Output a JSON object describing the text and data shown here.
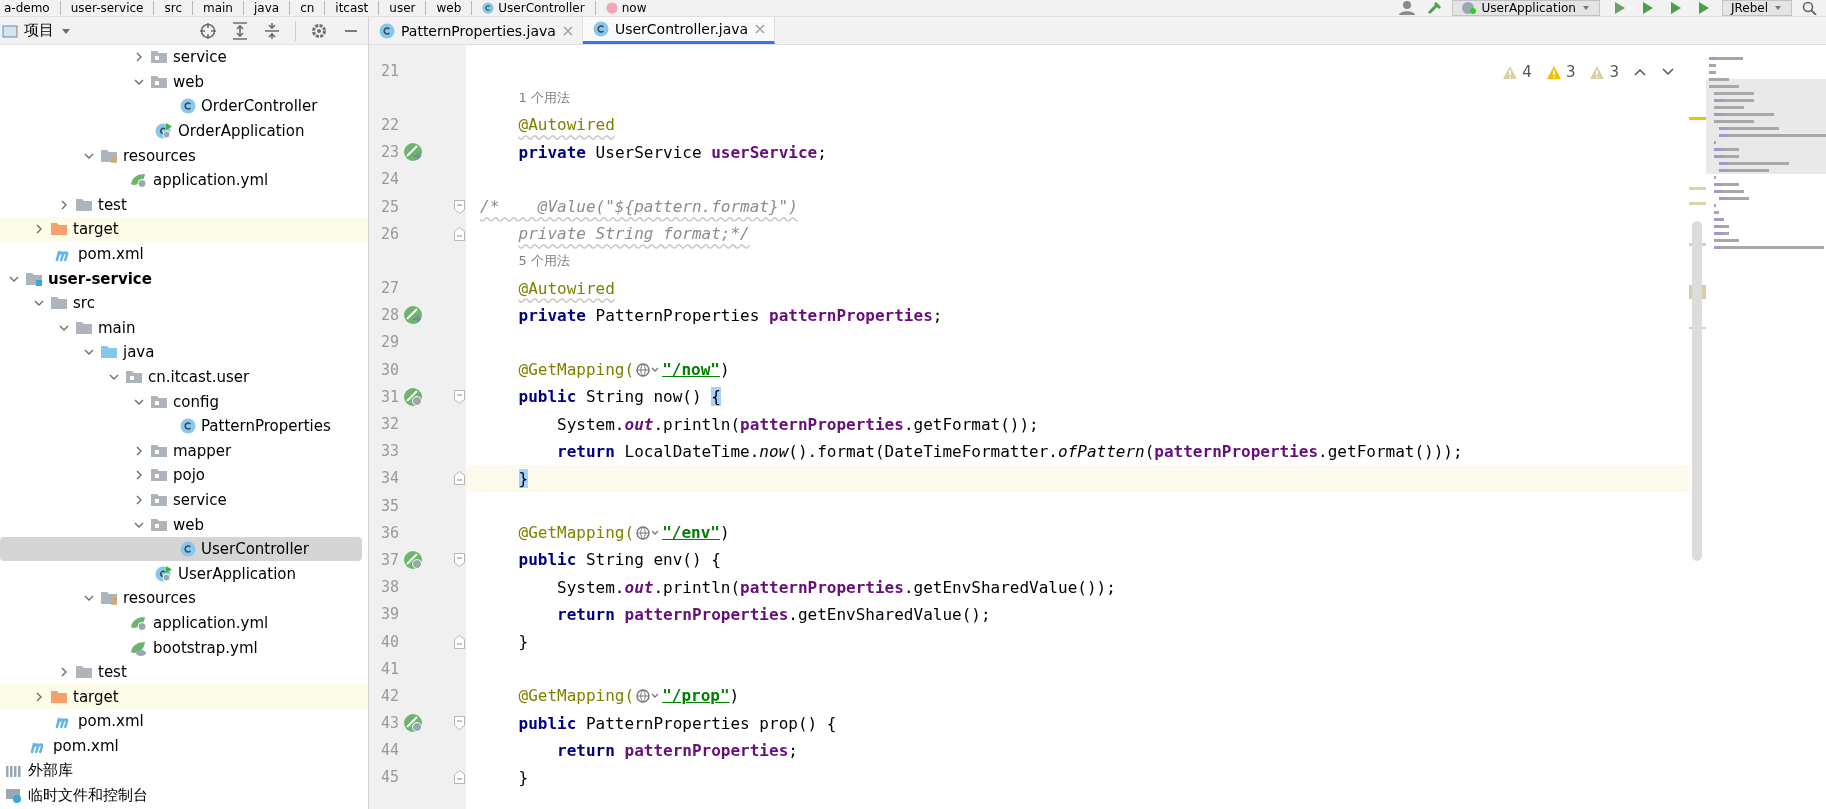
{
  "breadcrumb": [
    {
      "label": "a-demo",
      "kind": "folder"
    },
    {
      "label": "user-service",
      "kind": "folder"
    },
    {
      "label": "src",
      "kind": "folder"
    },
    {
      "label": "main",
      "kind": "folder"
    },
    {
      "label": "java",
      "kind": "folder"
    },
    {
      "label": "cn",
      "kind": "folder"
    },
    {
      "label": "itcast",
      "kind": "folder"
    },
    {
      "label": "user",
      "kind": "folder"
    },
    {
      "label": "web",
      "kind": "folder"
    },
    {
      "label": "UserController",
      "kind": "class"
    },
    {
      "label": "now",
      "kind": "method"
    }
  ],
  "toolbar": {
    "run_config": "UserApplication",
    "jrebel": "JRebel"
  },
  "project_panel": {
    "title": "项目",
    "tree": [
      {
        "children": [
          {
            "children": [
              {
                "children": [
                  {
                    "children": [
                      {
                        "children": [
                          {
                            "children": [
                              {
                                "label": "service",
                                "kind": "package",
                                "expanded": false,
                                "selected": false
                              },
                              {
                                "label": "web",
                                "kind": "package",
                                "expanded": true,
                                "selected": false,
                                "children": [
                                  {
                                    "label": "OrderController",
                                    "kind": "class",
                                    "selected": false
                                  }
                                ]
                              },
                              {
                                "label": "OrderApplication",
                                "kind": "app-class",
                                "selected": false
                              }
                            ]
                          }
                        ]
                      },
                      {
                        "label": "resources",
                        "kind": "resources-folder",
                        "expanded": true,
                        "selected": false,
                        "children": [
                          {
                            "label": "application.yml",
                            "kind": "yml",
                            "selected": false
                          }
                        ]
                      }
                    ]
                  },
                  {
                    "label": "test",
                    "kind": "folder",
                    "expanded": false,
                    "selected": false
                  }
                ]
              },
              {
                "label": "target",
                "kind": "excluded-folder",
                "expanded": false,
                "selected": false
              },
              {
                "label": "pom.xml",
                "kind": "maven",
                "selected": false
              }
            ]
          },
          {
            "label": "user-service",
            "kind": "module",
            "expanded": true,
            "selected": false,
            "children": [
              {
                "label": "src",
                "kind": "folder",
                "expanded": true,
                "selected": false,
                "children": [
                  {
                    "label": "main",
                    "kind": "folder",
                    "expanded": true,
                    "selected": false,
                    "children": [
                      {
                        "label": "java",
                        "kind": "source-folder",
                        "expanded": true,
                        "selected": false,
                        "children": [
                          {
                            "label": "cn.itcast.user",
                            "kind": "package",
                            "expanded": true,
                            "selected": false,
                            "children": [
                              {
                                "label": "config",
                                "kind": "package",
                                "expanded": true,
                                "selected": false,
                                "children": [
                                  {
                                    "label": "PatternProperties",
                                    "kind": "class",
                                    "selected": false
                                  }
                                ]
                              },
                              {
                                "label": "mapper",
                                "kind": "package",
                                "expanded": false,
                                "selected": false
                              },
                              {
                                "label": "pojo",
                                "kind": "package",
                                "expanded": false,
                                "selected": false
                              },
                              {
                                "label": "service",
                                "kind": "package",
                                "expanded": false,
                                "selected": false
                              },
                              {
                                "label": "web",
                                "kind": "package",
                                "expanded": true,
                                "selected": false,
                                "children": [
                                  {
                                    "label": "UserController",
                                    "kind": "class",
                                    "selected": true
                                  }
                                ]
                              },
                              {
                                "label": "UserApplication",
                                "kind": "app-class",
                                "selected": false
                              }
                            ]
                          }
                        ]
                      },
                      {
                        "label": "resources",
                        "kind": "resources-folder",
                        "expanded": true,
                        "selected": false,
                        "children": [
                          {
                            "label": "application.yml",
                            "kind": "yml",
                            "selected": false
                          },
                          {
                            "label": "bootstrap.yml",
                            "kind": "bootstrap-yml",
                            "selected": false
                          }
                        ]
                      }
                    ]
                  },
                  {
                    "label": "test",
                    "kind": "folder",
                    "expanded": false,
                    "selected": false
                  }
                ]
              },
              {
                "label": "target",
                "kind": "excluded-folder",
                "expanded": false,
                "selected": false
              },
              {
                "label": "pom.xml",
                "kind": "maven",
                "selected": false
              }
            ]
          },
          {
            "label": "pom.xml",
            "kind": "maven",
            "selected": false
          }
        ]
      },
      {
        "label": "外部库",
        "kind": "libraries",
        "selected": false
      },
      {
        "label": "临时文件和控制台",
        "kind": "scratches",
        "selected": false
      }
    ]
  },
  "tabs": [
    {
      "label": "PatternProperties.java",
      "selected": false
    },
    {
      "label": "UserController.java",
      "selected": true
    }
  ],
  "inspections": [
    {
      "kind": "weak-warning",
      "count": "4"
    },
    {
      "kind": "warning",
      "count": "3"
    },
    {
      "kind": "typo",
      "count": "3"
    }
  ],
  "code": [
    {
      "kind": "code",
      "number": "21"
    },
    {
      "kind": "hint",
      "text": "1 个用法"
    },
    {
      "kind": "code",
      "number": "22",
      "tokens": [
        {
          "kind": "annotation-warn",
          "text": "    @Autowired"
        }
      ]
    },
    {
      "kind": "code",
      "number": "23",
      "marker": {
        "kind": "bean"
      },
      "tokens": [
        {
          "kind": "keyword",
          "text": "    private"
        },
        {
          "kind": "plain",
          "text": " UserService "
        },
        {
          "kind": "field",
          "text": "userService"
        },
        {
          "kind": "plain",
          "text": ";"
        }
      ]
    },
    {
      "kind": "code",
      "number": "24"
    },
    {
      "kind": "code",
      "number": "25",
      "fold": {
        "kind": "start"
      },
      "tokens": [
        {
          "kind": "comment-warn",
          "text": "/*    @Value(\"${pattern.format}\")"
        }
      ]
    },
    {
      "kind": "code",
      "number": "26",
      "fold": {
        "kind": "end"
      },
      "tokens": [
        {
          "kind": "comment-warn",
          "text": "    private String format;*/"
        }
      ]
    },
    {
      "kind": "hint",
      "text": "5 个用法"
    },
    {
      "kind": "code",
      "number": "27",
      "tokens": [
        {
          "kind": "annotation-warn",
          "text": "    @Autowired"
        }
      ]
    },
    {
      "kind": "code",
      "number": "28",
      "marker": {
        "kind": "bean"
      },
      "tokens": [
        {
          "kind": "keyword",
          "text": "    private"
        },
        {
          "kind": "plain",
          "text": " PatternProperties "
        },
        {
          "kind": "field",
          "text": "patternProperties"
        },
        {
          "kind": "plain",
          "text": ";"
        }
      ]
    },
    {
      "kind": "code",
      "number": "29"
    },
    {
      "kind": "code",
      "number": "30",
      "tokens": [
        {
          "kind": "annotation",
          "text": "    @GetMapping("
        },
        {
          "kind": "globe"
        },
        {
          "kind": "url",
          "text": "\"/now\""
        },
        {
          "kind": "plain",
          "text": ")"
        }
      ]
    },
    {
      "kind": "code",
      "number": "31",
      "marker": {
        "kind": "endpoint"
      },
      "fold": {
        "kind": "start"
      },
      "tokens": [
        {
          "kind": "keyword",
          "text": "    public"
        },
        {
          "kind": "plain",
          "text": " String now() "
        },
        {
          "kind": "brace-match",
          "text": "{"
        }
      ]
    },
    {
      "kind": "code",
      "number": "32",
      "tokens": [
        {
          "kind": "plain",
          "text": "        System."
        },
        {
          "kind": "static-field",
          "text": "out"
        },
        {
          "kind": "plain",
          "text": ".println("
        },
        {
          "kind": "field",
          "text": "patternProperties"
        },
        {
          "kind": "plain",
          "text": ".getFormat());"
        }
      ]
    },
    {
      "kind": "code",
      "number": "33",
      "tokens": [
        {
          "kind": "keyword",
          "text": "        return"
        },
        {
          "kind": "plain",
          "text": " LocalDateTime."
        },
        {
          "kind": "static-method",
          "text": "now"
        },
        {
          "kind": "plain",
          "text": "().format(DateTimeFormatter."
        },
        {
          "kind": "static-method",
          "text": "ofPattern"
        },
        {
          "kind": "plain",
          "text": "("
        },
        {
          "kind": "field",
          "text": "patternProperties"
        },
        {
          "kind": "plain",
          "text": ".getFormat()));"
        }
      ]
    },
    {
      "kind": "current",
      "number": "34",
      "fold": {
        "kind": "end"
      },
      "tokens": [
        {
          "kind": "brace-match",
          "text": "    }"
        }
      ]
    },
    {
      "kind": "code",
      "number": "35"
    },
    {
      "kind": "code",
      "number": "36",
      "tokens": [
        {
          "kind": "annotation",
          "text": "    @GetMapping("
        },
        {
          "kind": "globe"
        },
        {
          "kind": "url",
          "text": "\"/env\""
        },
        {
          "kind": "plain",
          "text": ")"
        }
      ]
    },
    {
      "kind": "code",
      "number": "37",
      "marker": {
        "kind": "endpoint"
      },
      "fold": {
        "kind": "start"
      },
      "tokens": [
        {
          "kind": "keyword",
          "text": "    public"
        },
        {
          "kind": "plain",
          "text": " String env() {"
        }
      ]
    },
    {
      "kind": "code",
      "number": "38",
      "tokens": [
        {
          "kind": "plain",
          "text": "        System."
        },
        {
          "kind": "static-field",
          "text": "out"
        },
        {
          "kind": "plain",
          "text": ".println("
        },
        {
          "kind": "field",
          "text": "patternProperties"
        },
        {
          "kind": "plain",
          "text": ".getEnvSharedValue());"
        }
      ]
    },
    {
      "kind": "code",
      "number": "39",
      "tokens": [
        {
          "kind": "keyword",
          "text": "        return"
        },
        {
          "kind": "field",
          "text": " patternProperties"
        },
        {
          "kind": "plain",
          "text": ".getEnvSharedValue();"
        }
      ]
    },
    {
      "kind": "code",
      "number": "40",
      "fold": {
        "kind": "end"
      },
      "tokens": [
        {
          "kind": "plain",
          "text": "    }"
        }
      ]
    },
    {
      "kind": "code",
      "number": "41"
    },
    {
      "kind": "code",
      "number": "42",
      "tokens": [
        {
          "kind": "annotation",
          "text": "    @GetMapping("
        },
        {
          "kind": "globe"
        },
        {
          "kind": "url",
          "text": "\"/prop\""
        },
        {
          "kind": "plain",
          "text": ")"
        }
      ]
    },
    {
      "kind": "code",
      "number": "43",
      "marker": {
        "kind": "endpoint"
      },
      "fold": {
        "kind": "start"
      },
      "tokens": [
        {
          "kind": "keyword",
          "text": "    public"
        },
        {
          "kind": "plain",
          "text": " PatternProperties prop() {"
        }
      ]
    },
    {
      "kind": "code",
      "number": "44",
      "tokens": [
        {
          "kind": "keyword",
          "text": "        return"
        },
        {
          "kind": "field",
          "text": " patternProperties"
        },
        {
          "kind": "plain",
          "text": ";"
        }
      ]
    },
    {
      "kind": "code",
      "number": "45",
      "fold": {
        "kind": "end"
      },
      "tokens": [
        {
          "kind": "plain",
          "text": "    }"
        }
      ]
    }
  ]
}
